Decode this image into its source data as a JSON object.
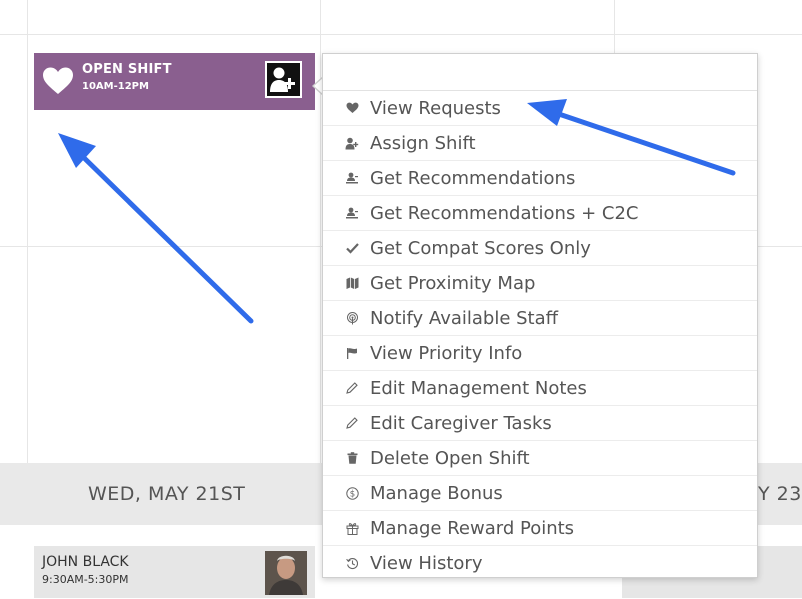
{
  "open_shift": {
    "title": "OPEN SHIFT",
    "time": "10AM-12PM",
    "bg_color": "#8a5f8f",
    "heart_icon": "heart-icon",
    "assign_icon": "assign-person-plus-icon"
  },
  "day_labels": {
    "left": "WED, MAY 21ST",
    "right": "Y 23"
  },
  "shift_card": {
    "name": "JOHN BLACK",
    "time": "9:30AM-5:30PM"
  },
  "menu": {
    "items": [
      {
        "label": "View Requests",
        "icon": "heart-icon"
      },
      {
        "label": "Assign Shift",
        "icon": "assign-user-icon"
      },
      {
        "label": "Get Recommendations",
        "icon": "recommend-icon"
      },
      {
        "label": "Get Recommendations + C2C",
        "icon": "recommend-c2c-icon"
      },
      {
        "label": "Get Compat Scores Only",
        "icon": "check-icon"
      },
      {
        "label": "Get Proximity Map",
        "icon": "map-icon"
      },
      {
        "label": "Notify Available Staff",
        "icon": "broadcast-icon"
      },
      {
        "label": "View Priority Info",
        "icon": "flag-icon"
      },
      {
        "label": "Edit Management Notes",
        "icon": "pencil-icon"
      },
      {
        "label": "Edit Caregiver Tasks",
        "icon": "pencil-icon"
      },
      {
        "label": "Delete Open Shift",
        "icon": "trash-icon"
      },
      {
        "label": "Manage Bonus",
        "icon": "dollar-circle-icon"
      },
      {
        "label": "Manage Reward Points",
        "icon": "gift-icon"
      },
      {
        "label": "View History",
        "icon": "history-icon"
      }
    ]
  },
  "annotation_color": "#2f6bea"
}
